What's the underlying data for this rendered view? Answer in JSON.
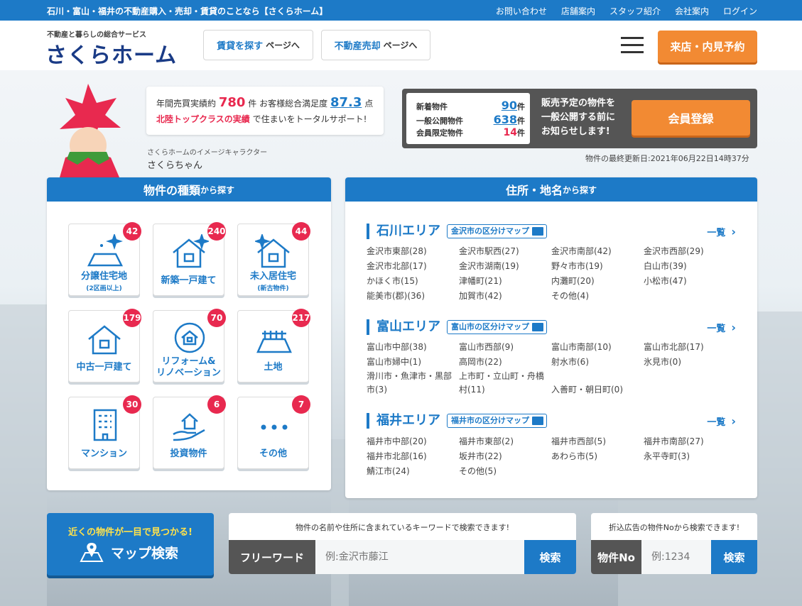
{
  "topbar": {
    "lead": "石川・富山・福井の不動産購入・売却・賃貸のことなら【さくらホーム】",
    "links": [
      "お問い合わせ",
      "店舗案内",
      "スタッフ紹介",
      "会社案内",
      "ログイン"
    ]
  },
  "header": {
    "logo_sub": "不動産と暮らしの総合サービス",
    "logo": "さくらホーム",
    "rent_label": "賃貸を探す",
    "rent_sub": "ページへ",
    "sell_label": "不動産売却",
    "sell_sub": "ページへ",
    "reserve": "来店・内見予約"
  },
  "stats": {
    "sales_label": "年間売買実績約",
    "sales_value": "780",
    "sales_unit": "件",
    "satisfaction_label": "お客様総合満足度",
    "satisfaction_value": "87.3",
    "satisfaction_unit": "点",
    "highlight": "北陸トップクラスの実績",
    "tail": "で住まいをトータルサポート!"
  },
  "character": {
    "caption": "さくらホームのイメージキャラクター",
    "name": "さくらちゃん"
  },
  "counts": [
    {
      "label": "新着物件",
      "value": "90",
      "unit": "件"
    },
    {
      "label": "一般公開物件",
      "value": "638",
      "unit": "件"
    },
    {
      "label": "会員限定物件",
      "value": "14",
      "unit": "件"
    }
  ],
  "member": {
    "msg1": "販売予定の物件を",
    "msg2": "一般公開する前に",
    "msg3": "お知らせします!",
    "button": "会員登録"
  },
  "updated": "物件の最終更新日:2021年06月22日14時37分",
  "types": {
    "head": "物件の種類",
    "head_small": "から探す",
    "items": [
      {
        "label": "分譲住宅地",
        "sub": "(2区画以上)",
        "count": "42",
        "icon": "land-sparkle-icon"
      },
      {
        "label": "新築一戸建て",
        "sub": "",
        "count": "240",
        "icon": "new-house-icon"
      },
      {
        "label": "未入居住宅",
        "sub": "(新古物件)",
        "count": "44",
        "icon": "unoccupied-house-icon"
      },
      {
        "label": "中古一戸建て",
        "sub": "",
        "count": "179",
        "icon": "used-house-icon"
      },
      {
        "label": "リフォーム&",
        "label2": "リノベーション",
        "sub": "",
        "count": "70",
        "icon": "renovation-icon"
      },
      {
        "label": "土地",
        "sub": "",
        "count": "217",
        "icon": "land-icon"
      },
      {
        "label": "マンション",
        "sub": "",
        "count": "30",
        "icon": "mansion-icon"
      },
      {
        "label": "投資物件",
        "sub": "",
        "count": "6",
        "icon": "investment-icon"
      },
      {
        "label": "その他",
        "sub": "",
        "count": "7",
        "icon": "more-icon"
      }
    ]
  },
  "areas": {
    "head": "住所・地名",
    "head_small": "から探す",
    "list_label": "一覧",
    "groups": [
      {
        "title": "石川エリア",
        "map": "金沢市の区分けマップ",
        "cities": [
          "金沢市東部(28)",
          "金沢市駅西(27)",
          "金沢市南部(42)",
          "金沢市西部(29)",
          "金沢市北部(17)",
          "金沢市湖南(19)",
          "野々市市(19)",
          "白山市(39)",
          "かほく市(15)",
          "津幡町(21)",
          "内灘町(20)",
          "小松市(47)",
          "能美市(郡)(36)",
          "加賀市(42)",
          "その他(4)"
        ]
      },
      {
        "title": "富山エリア",
        "map": "富山市の区分けマップ",
        "cities": [
          "富山市中部(38)",
          "富山市西部(9)",
          "富山市南部(10)",
          "富山市北部(17)",
          "富山市婦中(1)",
          "高岡市(22)",
          "射水市(6)",
          "氷見市(0)",
          "滑川市・魚津市・黒部市(3)",
          "上市町・立山町・舟橋村(11)",
          "入善町・朝日町(0)"
        ]
      },
      {
        "title": "福井エリア",
        "map": "福井市の区分けマップ",
        "cities": [
          "福井市中部(20)",
          "福井市東部(2)",
          "福井市西部(5)",
          "福井市南部(27)",
          "福井市北部(16)",
          "坂井市(22)",
          "あわら市(5)",
          "永平寺町(3)",
          "鯖江市(24)",
          "その他(5)"
        ]
      }
    ]
  },
  "mapsearch": {
    "line1": "近くの物件が一目で見つかる!",
    "line2": "マップ検索"
  },
  "freeword": {
    "hint": "物件の名前や住所に含まれているキーワードで検索できます!",
    "label": "フリーワード",
    "placeholder": "例:金沢市藤江",
    "button": "検索"
  },
  "propno": {
    "hint": "折込広告の物件Noから検索できます!",
    "label": "物件No",
    "placeholder": "例:1234",
    "button": "検索"
  }
}
